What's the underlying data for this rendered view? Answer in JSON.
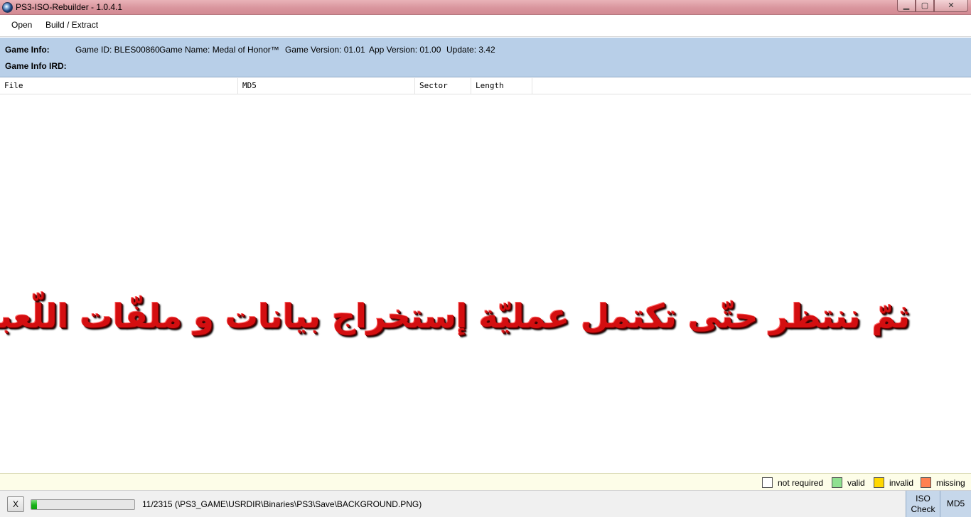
{
  "window": {
    "title": "PS3-ISO-Rebuilder - 1.0.4.1",
    "min_glyph": "▁",
    "max_glyph": "▢",
    "close_glyph": "✕"
  },
  "menu": {
    "open_label": "Open",
    "build_label": "Build / Extract"
  },
  "game_info": {
    "label": "Game Info:",
    "ird_label": "Game Info IRD:",
    "game_id": "Game ID: BLES00860",
    "game_name": "Game Name: Medal of Honor™",
    "game_version": "Game Version: 01.01",
    "app_version": "App Version: 01.00",
    "update": "Update: 3.42"
  },
  "columns": {
    "file": "File",
    "md5": "MD5",
    "sector": "Sector",
    "length": "Length"
  },
  "overlay_caption": "ثمّ ننتظر حتّى تكتمل عمليّة إستخراج بيانات و ملفّات اللّعبة.",
  "legend": [
    {
      "label": "not required",
      "color": "#ffffff"
    },
    {
      "label": "valid",
      "color": "#90e090"
    },
    {
      "label": "invalid",
      "color": "#ffd800"
    },
    {
      "label": "missing",
      "color": "#ff8050"
    }
  ],
  "status": {
    "cancel_label": "X",
    "progress_fraction": 0.0048,
    "progress_text": "11/2315 (\\PS3_GAME\\USRDIR\\Binaries\\PS3\\Save\\BACKGROUND.PNG)",
    "iso_check_label_1": "ISO",
    "iso_check_label_2": "Check",
    "md5_label": "MD5"
  }
}
